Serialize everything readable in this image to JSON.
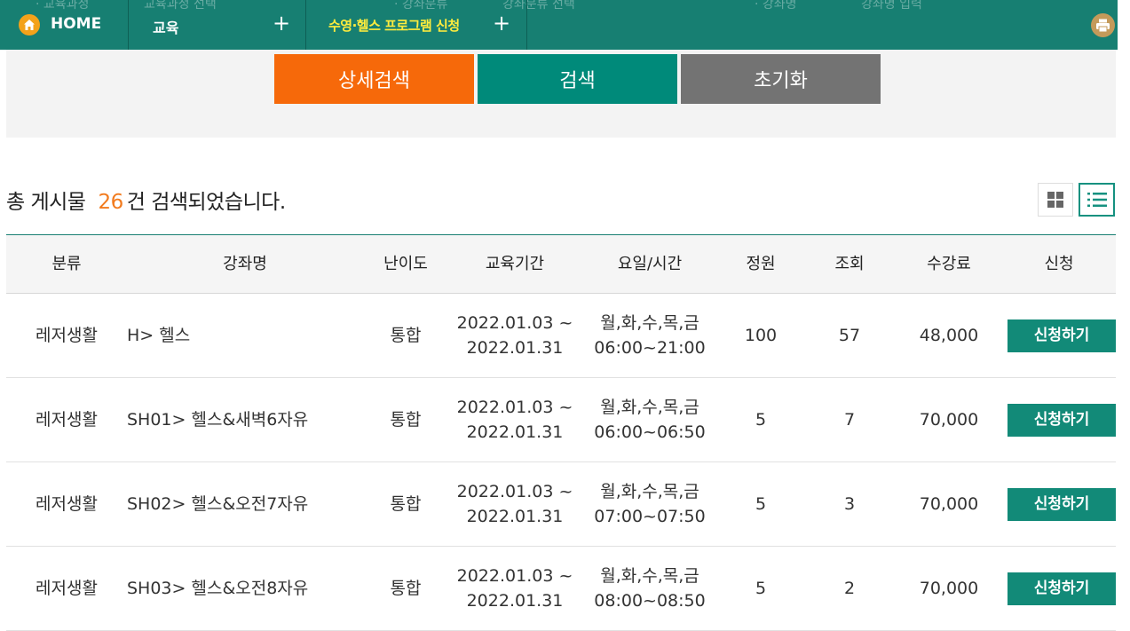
{
  "nav": {
    "home_label": "HOME",
    "menu_label": "교육",
    "submenu_label": "수영·헬스 프로그램 신청",
    "plus_symbol": "+",
    "ghost_texts": [
      "· 교육과정",
      "교육과정 선택",
      "· 강좌분류",
      "강좌분류 선택",
      "· 강좌명",
      "강좌명 입력"
    ],
    "colors": {
      "bar": "#177f72",
      "submenu_text": "#ffec3d",
      "home_icon": "#f3a21a",
      "print_icon": "#c49a5a"
    }
  },
  "search": {
    "detail_button": "상세검색",
    "search_button": "검색",
    "reset_button": "초기화",
    "colors": {
      "detail": "#f6690a",
      "search": "#008a7a",
      "reset": "#737373"
    }
  },
  "summary": {
    "prefix": "총 게시물",
    "count": "26",
    "suffix": "건 검색되었습니다."
  },
  "table": {
    "headers": [
      "분류",
      "강좌명",
      "난이도",
      "교육기간",
      "요일/시간",
      "정원",
      "조회",
      "수강료",
      "신청"
    ],
    "rows": [
      {
        "category": "레저생활",
        "name": "H> 헬스",
        "level": "통합",
        "period_start": "2022.01.03 ~",
        "period_end": "2022.01.31",
        "days": "월,화,수,목,금",
        "time": "06:00~21:00",
        "capacity": "100",
        "views": "57",
        "fee": "48,000",
        "action": "신청하기"
      },
      {
        "category": "레저생활",
        "name": "SH01> 헬스&새벽6자유",
        "level": "통합",
        "period_start": "2022.01.03 ~",
        "period_end": "2022.01.31",
        "days": "월,화,수,목,금",
        "time": "06:00~06:50",
        "capacity": "5",
        "views": "7",
        "fee": "70,000",
        "action": "신청하기"
      },
      {
        "category": "레저생활",
        "name": "SH02> 헬스&오전7자유",
        "level": "통합",
        "period_start": "2022.01.03 ~",
        "period_end": "2022.01.31",
        "days": "월,화,수,목,금",
        "time": "07:00~07:50",
        "capacity": "5",
        "views": "3",
        "fee": "70,000",
        "action": "신청하기"
      },
      {
        "category": "레저생활",
        "name": "SH03> 헬스&오전8자유",
        "level": "통합",
        "period_start": "2022.01.03 ~",
        "period_end": "2022.01.31",
        "days": "월,화,수,목,금",
        "time": "08:00~08:50",
        "capacity": "5",
        "views": "2",
        "fee": "70,000",
        "action": "신청하기"
      }
    ]
  }
}
